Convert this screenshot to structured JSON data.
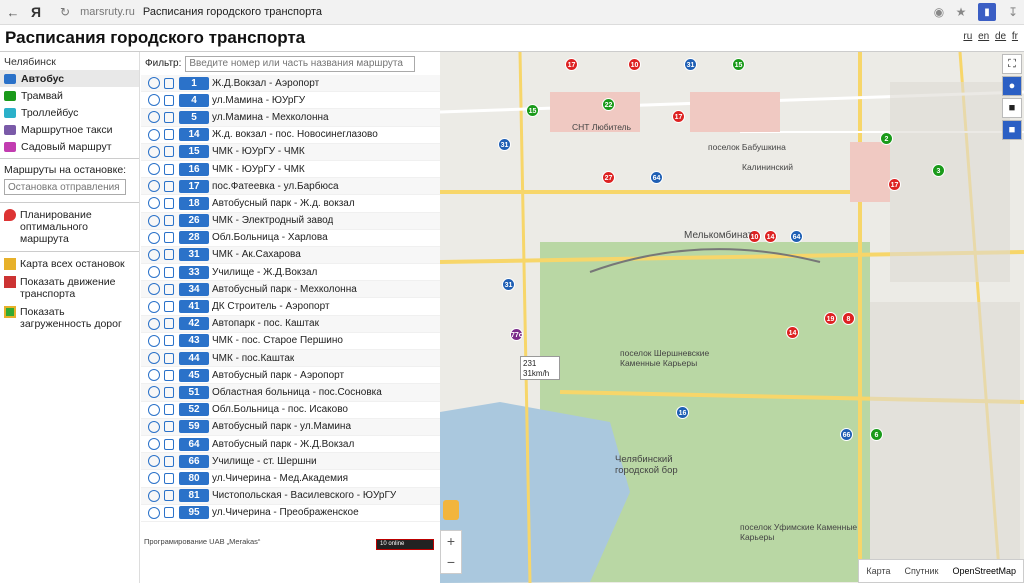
{
  "browser": {
    "host": "marsruty.ru",
    "title": "Расписания городского транспорта",
    "yandex_logo": "Я"
  },
  "header": {
    "title": "Расписания городского транспорта",
    "langs": [
      "ru",
      "en",
      "de",
      "fr"
    ]
  },
  "sidebar": {
    "city": "Челябинск",
    "modes": [
      {
        "label": "Автобус",
        "color": "#2b72c9",
        "active": true
      },
      {
        "label": "Трамвай",
        "color": "#1a9a1a"
      },
      {
        "label": "Троллейбус",
        "color": "#2bb0c9"
      },
      {
        "label": "Маршрутное такси",
        "color": "#7a5aa8"
      },
      {
        "label": "Садовый маршрут",
        "color": "#c23cb0"
      }
    ],
    "stop_label": "Маршруты на остановке:",
    "stop_placeholder": "Остановка отправления",
    "tools": [
      "Планирование оптимального маршрута",
      "Карта всех остановок",
      "Показать движение транспорта",
      "Показать загруженность дорог"
    ]
  },
  "routes": {
    "filter_label": "Фильтр:",
    "filter_placeholder": "Введите номер или часть названия маршрута",
    "items": [
      {
        "num": "1",
        "name": "Ж.Д.Вокзал - Аэропорт"
      },
      {
        "num": "4",
        "name": "ул.Мамина - ЮУрГУ"
      },
      {
        "num": "5",
        "name": "ул.Мамина - Мехколонна"
      },
      {
        "num": "14",
        "name": "Ж.д. вокзал - пос. Новосинеглазово"
      },
      {
        "num": "15",
        "name": "ЧМК - ЮУрГУ - ЧМК"
      },
      {
        "num": "16",
        "name": "ЧМК - ЮУрГУ - ЧМК"
      },
      {
        "num": "17",
        "name": "пос.Фатеевка - ул.Барбюса"
      },
      {
        "num": "18",
        "name": "Автобусный парк - Ж.д. вокзал"
      },
      {
        "num": "26",
        "name": "ЧМК - Электродный завод"
      },
      {
        "num": "28",
        "name": "Обл.Больница - Харлова"
      },
      {
        "num": "31",
        "name": "ЧМК - Ак.Сахарова"
      },
      {
        "num": "33",
        "name": "Училище - Ж.Д.Вокзал"
      },
      {
        "num": "34",
        "name": "Автобусный парк - Мехколонна"
      },
      {
        "num": "41",
        "name": "ДК Строитель - Аэропорт"
      },
      {
        "num": "42",
        "name": "Автопарк - пос. Каштак"
      },
      {
        "num": "43",
        "name": "ЧМК - пос. Старое Першино"
      },
      {
        "num": "44",
        "name": "ЧМК - пос.Каштак"
      },
      {
        "num": "45",
        "name": "Автобусный парк - Аэропорт"
      },
      {
        "num": "51",
        "name": "Областная больница - пос.Сосновка"
      },
      {
        "num": "52",
        "name": "Обл.Больница - пос. Исаково"
      },
      {
        "num": "59",
        "name": "Автобусный парк - ул.Мамина"
      },
      {
        "num": "64",
        "name": "Автобусный парк - Ж.Д.Вокзал"
      },
      {
        "num": "66",
        "name": "Училище - ст. Шершни"
      },
      {
        "num": "80",
        "name": "ул.Чичерина - Мед.Академия"
      },
      {
        "num": "81",
        "name": "Чистопольская - Василевского - ЮУрГУ"
      },
      {
        "num": "95",
        "name": "ул.Чичерина - Преображенское"
      }
    ],
    "credits": "Програмирование UAB „Merakas“",
    "counter": "10 online"
  },
  "map": {
    "labels": [
      "Мелькомбинат",
      "поселок Бабушкина",
      "Калининский",
      "поселок Шершневские Каменные Карьеры",
      "Челябинский городской бор",
      "поселок Уфимские Каменные Карьеры",
      "СНТ Любитель"
    ],
    "popup": [
      "231",
      "31km/h"
    ],
    "types": [
      "Карта",
      "Спутник",
      "OpenStreetMap"
    ],
    "markers": [
      {
        "n": "17",
        "c": "red"
      },
      {
        "n": "10",
        "c": "red"
      },
      {
        "n": "31",
        "c": "blue"
      },
      {
        "n": "15",
        "c": "green"
      },
      {
        "n": "22",
        "c": "green"
      },
      {
        "n": "15",
        "c": "green"
      },
      {
        "n": "17",
        "c": "red"
      },
      {
        "n": "31",
        "c": "blue"
      },
      {
        "n": "27",
        "c": "red"
      },
      {
        "n": "64",
        "c": "blue"
      },
      {
        "n": "10",
        "c": "red"
      },
      {
        "n": "14",
        "c": "red"
      },
      {
        "n": "64",
        "c": "blue"
      },
      {
        "n": "31",
        "c": "blue"
      },
      {
        "n": "77c",
        "c": "purple"
      },
      {
        "n": "16",
        "c": "blue"
      },
      {
        "n": "19",
        "c": "red"
      },
      {
        "n": "8",
        "c": "red"
      },
      {
        "n": "66",
        "c": "blue"
      },
      {
        "n": "6",
        "c": "green"
      },
      {
        "n": "14",
        "c": "red"
      },
      {
        "n": "3",
        "c": "green"
      },
      {
        "n": "2",
        "c": "green"
      },
      {
        "n": "17",
        "c": "red"
      }
    ]
  }
}
